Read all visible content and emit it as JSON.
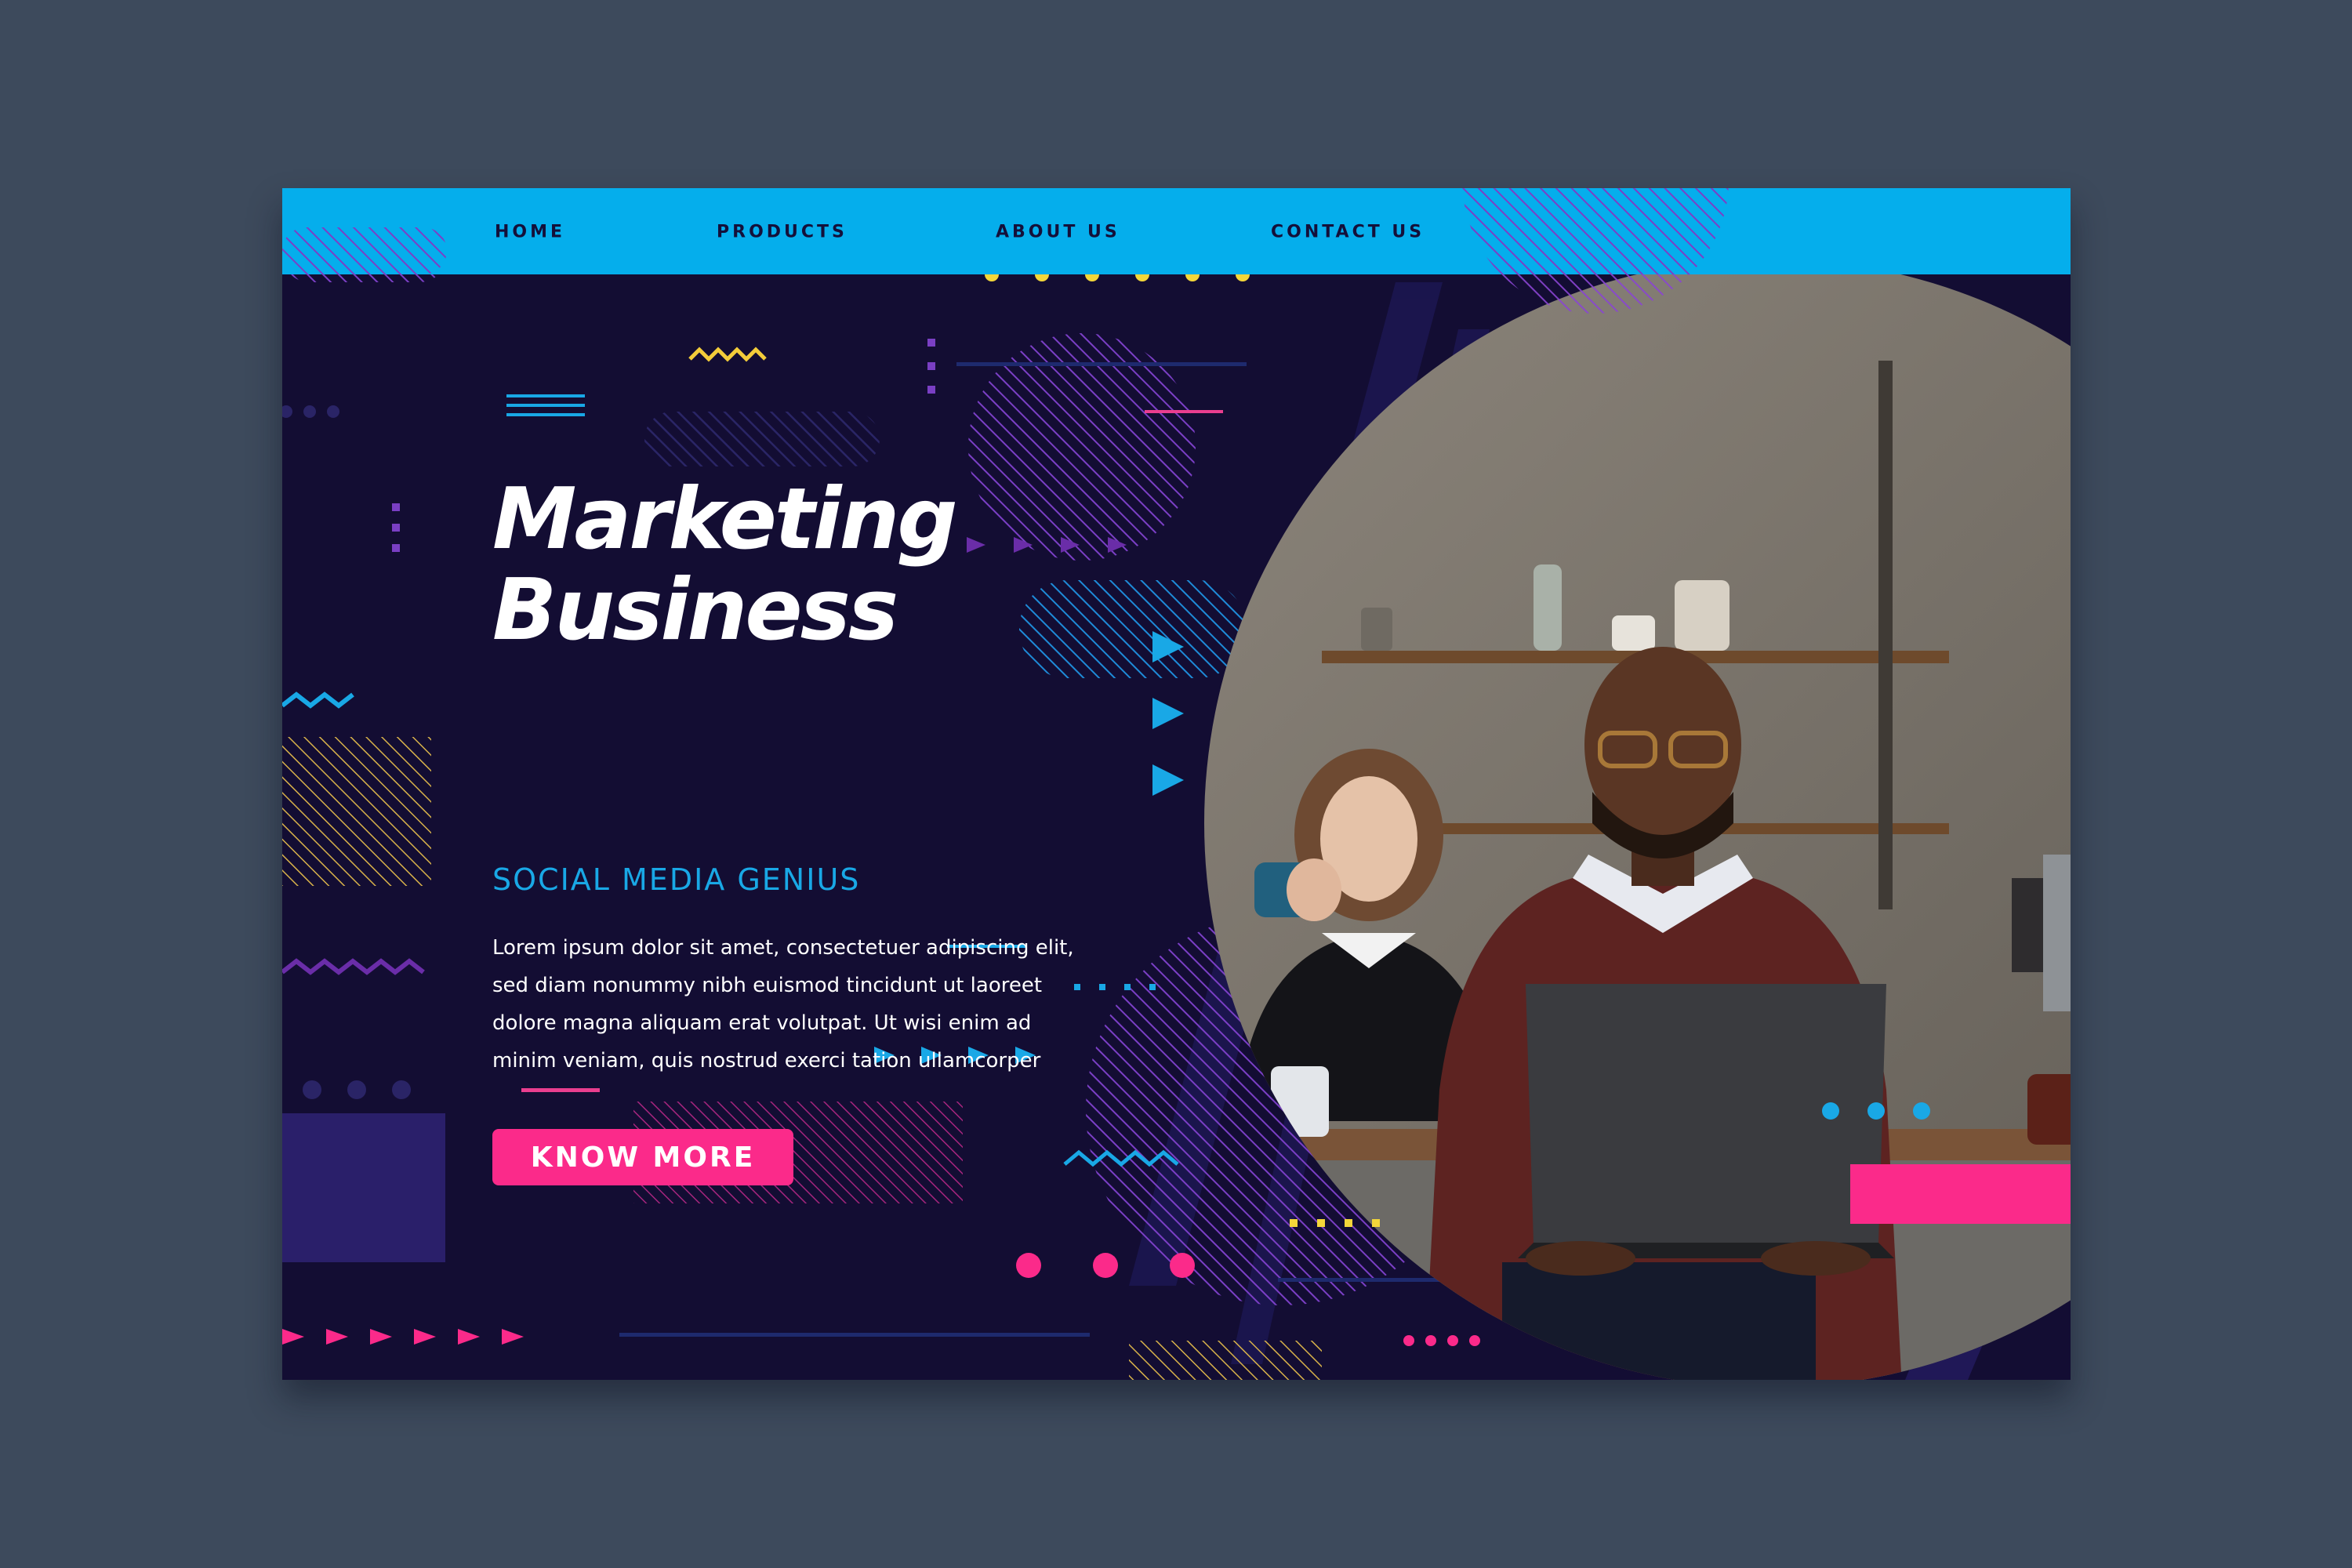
{
  "nav": {
    "items": [
      {
        "label": "HOME"
      },
      {
        "label": "PRODUCTS"
      },
      {
        "label": "ABOUT US"
      },
      {
        "label": "CONTACT US"
      }
    ]
  },
  "hero": {
    "title_line1": "Marketing",
    "title_line2": "Business",
    "subtitle": "SOCIAL MEDIA GENIUS",
    "body_lines": [
      "Lorem ipsum dolor sit amet, consectetuer adipiscing elit,",
      "sed diam nonummy nibh euismod tincidunt ut laoreet",
      "dolore magna aliquam erat volutpat. Ut wisi enim ad",
      "minim veniam, quis nostrud exerci tation ullamcorper"
    ],
    "cta_label": "KNOW MORE"
  },
  "social": [
    {
      "icon": "instagram-icon"
    },
    {
      "icon": "twitter-icon"
    },
    {
      "icon": "facebook-icon"
    },
    {
      "icon": "youtube-icon"
    }
  ],
  "colors": {
    "background": "#3d4a5c",
    "canvas": "#130d33",
    "nav": "#05aeec",
    "accent_pink": "#fb2a8a",
    "accent_blue": "#19a8e6",
    "accent_purple": "#7a3fc4",
    "accent_yellow": "#f6d736"
  }
}
